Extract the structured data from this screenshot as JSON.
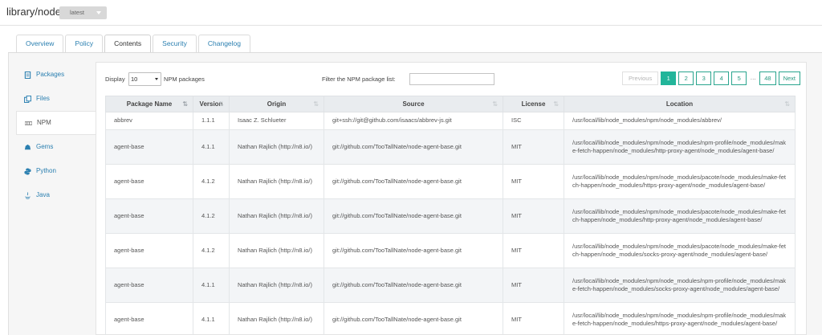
{
  "repo": {
    "name": "library/node",
    "tag": "latest"
  },
  "tabs": [
    {
      "label": "Overview"
    },
    {
      "label": "Policy"
    },
    {
      "label": "Contents"
    },
    {
      "label": "Security"
    },
    {
      "label": "Changelog"
    }
  ],
  "sidebar": {
    "items": [
      {
        "label": "Packages",
        "icon": "packages-icon"
      },
      {
        "label": "Files",
        "icon": "files-icon"
      },
      {
        "label": "NPM",
        "icon": "npm-icon"
      },
      {
        "label": "Gems",
        "icon": "gems-icon"
      },
      {
        "label": "Python",
        "icon": "python-icon"
      },
      {
        "label": "Java",
        "icon": "java-icon"
      }
    ],
    "active": "NPM"
  },
  "controls": {
    "display_label": "Display",
    "display_value": "10",
    "display_suffix": "NPM packages",
    "filter_label": "Filter the NPM package list:",
    "filter_value": ""
  },
  "pagination": {
    "previous": "Previous",
    "pages": [
      "1",
      "2",
      "3",
      "4",
      "5"
    ],
    "ellipsis": "…",
    "last": "48",
    "next": "Next",
    "current": "1"
  },
  "table": {
    "headers": [
      "Package Name",
      "Version",
      "Origin",
      "Source",
      "License",
      "Location"
    ],
    "rows": [
      {
        "name": "abbrev",
        "version": "1.1.1",
        "origin": "Isaac Z. Schlueter",
        "source": "git+ssh://git@github.com/isaacs/abbrev-js.git",
        "license": "ISC",
        "location": "/usr/local/lib/node_modules/npm/node_modules/abbrev/"
      },
      {
        "name": "agent-base",
        "version": "4.1.1",
        "origin": "Nathan Rajlich (http://n8.io/)",
        "source": "git://github.com/TooTallNate/node-agent-base.git",
        "license": "MIT",
        "location": "/usr/local/lib/node_modules/npm/node_modules/npm-profile/node_modules/make-fetch-happen/node_modules/http-proxy-agent/node_modules/agent-base/"
      },
      {
        "name": "agent-base",
        "version": "4.1.2",
        "origin": "Nathan Rajlich (http://n8.io/)",
        "source": "git://github.com/TooTallNate/node-agent-base.git",
        "license": "MIT",
        "location": "/usr/local/lib/node_modules/npm/node_modules/pacote/node_modules/make-fetch-happen/node_modules/https-proxy-agent/node_modules/agent-base/"
      },
      {
        "name": "agent-base",
        "version": "4.1.2",
        "origin": "Nathan Rajlich (http://n8.io/)",
        "source": "git://github.com/TooTallNate/node-agent-base.git",
        "license": "MIT",
        "location": "/usr/local/lib/node_modules/npm/node_modules/pacote/node_modules/make-fetch-happen/node_modules/http-proxy-agent/node_modules/agent-base/"
      },
      {
        "name": "agent-base",
        "version": "4.1.2",
        "origin": "Nathan Rajlich (http://n8.io/)",
        "source": "git://github.com/TooTallNate/node-agent-base.git",
        "license": "MIT",
        "location": "/usr/local/lib/node_modules/npm/node_modules/pacote/node_modules/make-fetch-happen/node_modules/socks-proxy-agent/node_modules/agent-base/"
      },
      {
        "name": "agent-base",
        "version": "4.1.1",
        "origin": "Nathan Rajlich (http://n8.io/)",
        "source": "git://github.com/TooTallNate/node-agent-base.git",
        "license": "MIT",
        "location": "/usr/local/lib/node_modules/npm/node_modules/npm-profile/node_modules/make-fetch-happen/node_modules/socks-proxy-agent/node_modules/agent-base/"
      },
      {
        "name": "agent-base",
        "version": "4.1.1",
        "origin": "Nathan Rajlich (http://n8.io/)",
        "source": "git://github.com/TooTallNate/node-agent-base.git",
        "license": "MIT",
        "location": "/usr/local/lib/node_modules/npm/node_modules/npm-profile/node_modules/make-fetch-happen/node_modules/https-proxy-agent/node_modules/agent-base/"
      }
    ]
  },
  "colors": {
    "link": "#2a7fb0",
    "accent": "#22b59a",
    "header_bg": "#e9ecef"
  }
}
